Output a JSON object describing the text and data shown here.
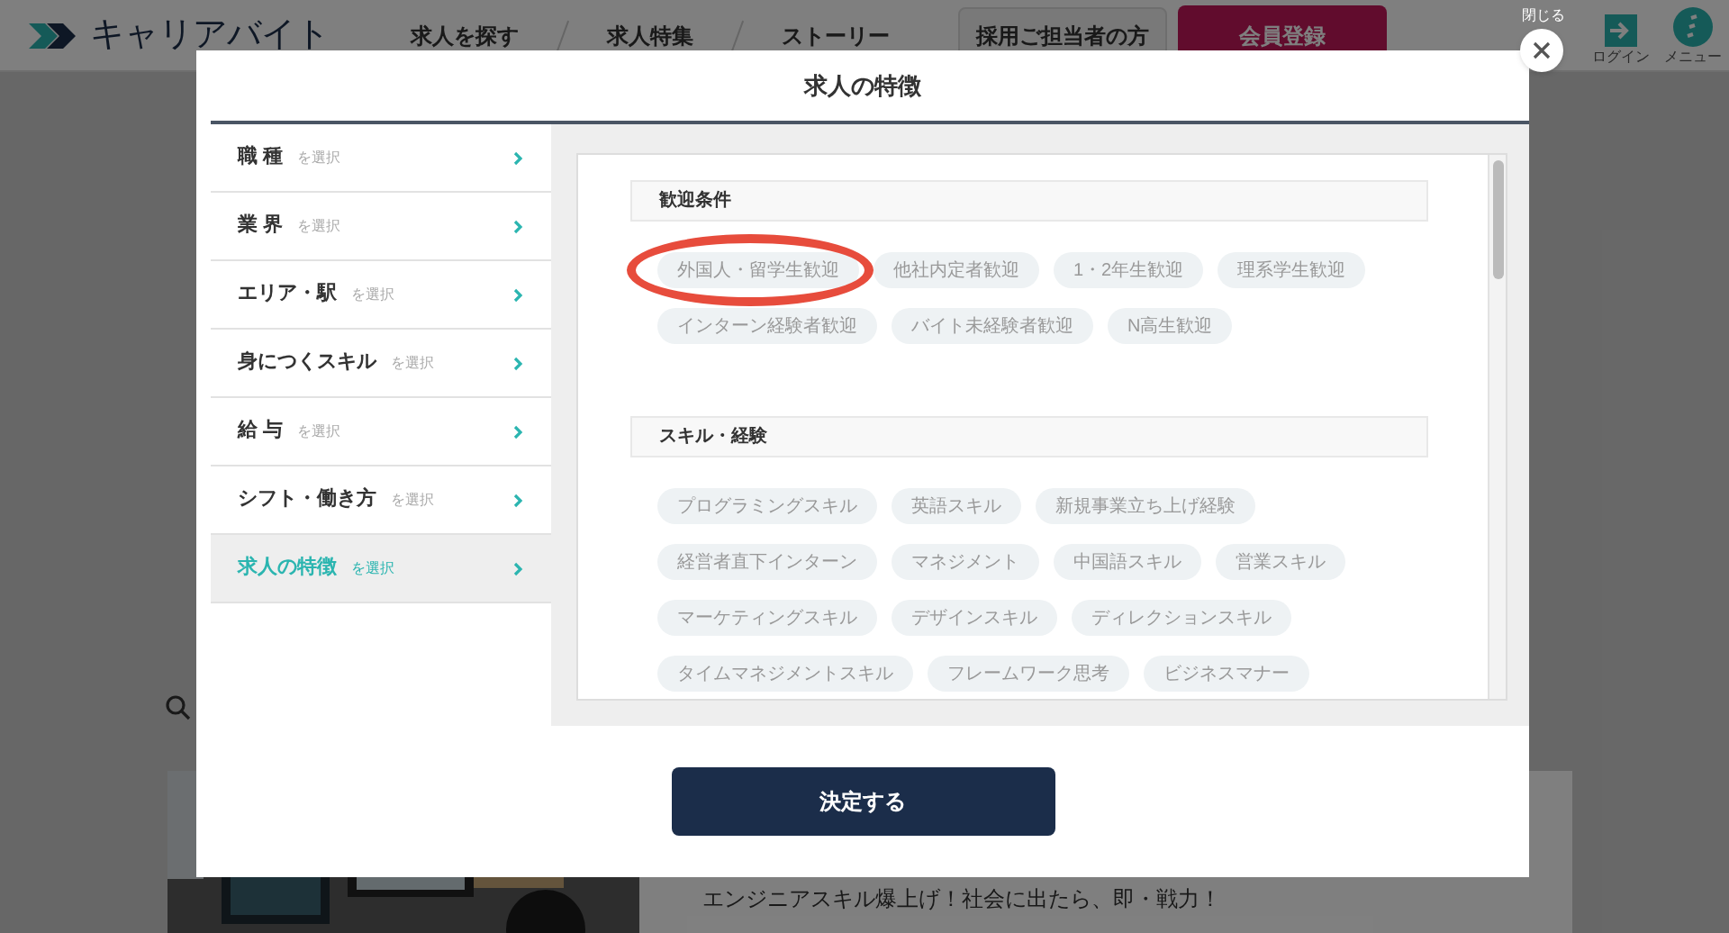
{
  "header": {
    "logo": "キャリアバイト",
    "nav": [
      "求人を探す",
      "求人特集",
      "ストーリー"
    ],
    "recruiter_button": "採用ご担当者の方",
    "signup_button": "会員登録",
    "login": "ログイン",
    "menu": "メニュー"
  },
  "background": {
    "card_text": "エンジニアスキル爆上げ！社会に出たら、即・戦力！"
  },
  "modal": {
    "close_label": "閉じる",
    "title": "求人の特徴",
    "sidebar": [
      {
        "label": "職 種",
        "hint": "を選択",
        "selected": false
      },
      {
        "label": "業 界",
        "hint": "を選択",
        "selected": false
      },
      {
        "label": "エリア・駅",
        "hint": "を選択",
        "selected": false
      },
      {
        "label": "身につくスキル",
        "hint": "を選択",
        "selected": false
      },
      {
        "label": "給 与",
        "hint": "を選択",
        "selected": false
      },
      {
        "label": "シフト・働き方",
        "hint": "を選択",
        "selected": false
      },
      {
        "label": "求人の特徴",
        "hint": "を選択",
        "selected": true
      }
    ],
    "sections": [
      {
        "title": "歓迎条件",
        "chips": [
          {
            "label": "外国人・留学生歓迎",
            "circled": true
          },
          {
            "label": "他社内定者歓迎",
            "circled": false
          },
          {
            "label": "1・2年生歓迎",
            "circled": false
          },
          {
            "label": "理系学生歓迎",
            "circled": false
          },
          {
            "label": "インターン経験者歓迎",
            "circled": false
          },
          {
            "label": "バイト未経験者歓迎",
            "circled": false
          },
          {
            "label": "N高生歓迎",
            "circled": false
          }
        ]
      },
      {
        "title": "スキル・経験",
        "chips": [
          {
            "label": "プログラミングスキル",
            "circled": false
          },
          {
            "label": "英語スキル",
            "circled": false
          },
          {
            "label": "新規事業立ち上げ経験",
            "circled": false
          },
          {
            "label": "経営者直下インターン",
            "circled": false
          },
          {
            "label": "マネジメント",
            "circled": false
          },
          {
            "label": "中国語スキル",
            "circled": false
          },
          {
            "label": "営業スキル",
            "circled": false
          },
          {
            "label": "マーケティングスキル",
            "circled": false
          },
          {
            "label": "デザインスキル",
            "circled": false
          },
          {
            "label": "ディレクションスキル",
            "circled": false
          },
          {
            "label": "タイムマネジメントスキル",
            "circled": false
          },
          {
            "label": "フレームワーク思考",
            "circled": false
          },
          {
            "label": "ビジネスマナー",
            "circled": false
          }
        ]
      }
    ],
    "submit_button": "決定する"
  }
}
